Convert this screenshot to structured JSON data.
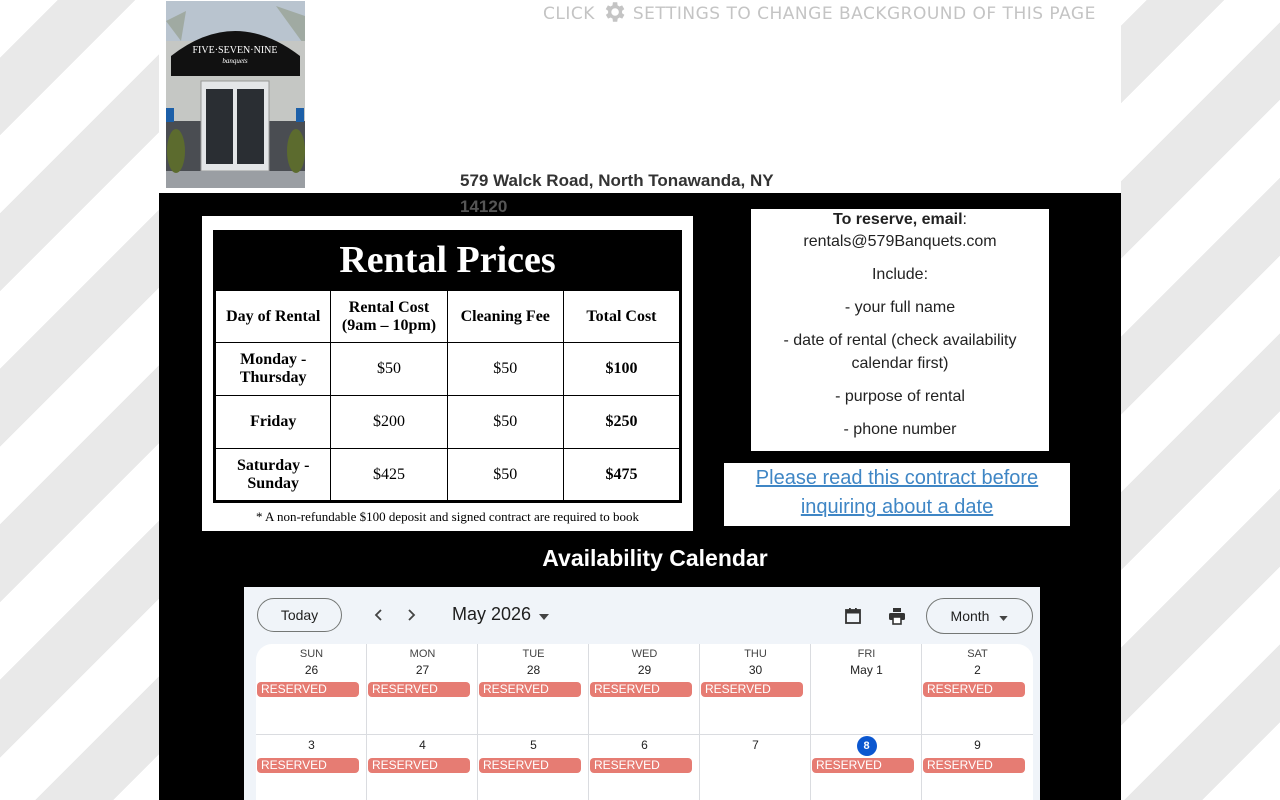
{
  "header": {
    "banner_text": "CLICK",
    "banner_text_2": "SETTINGS TO CHANGE BACKGROUND OF THIS PAGE",
    "logo_text": "FIVE·SEVEN·NINE",
    "logo_subtext": "banquets",
    "address": "579 Walck Road, North Tonawanda, NY",
    "zip": "14120"
  },
  "prices": {
    "title": "Rental Prices",
    "headers": [
      "Day of Rental",
      "Rental Cost (9am – 10pm)",
      "Cleaning Fee",
      "Total Cost"
    ],
    "rows": [
      {
        "day": "Monday - Thursday",
        "rental": "$50",
        "cleaning": "$50",
        "total": "$100"
      },
      {
        "day": "Friday",
        "rental": "$200",
        "cleaning": "$50",
        "total": "$250"
      },
      {
        "day": "Saturday - Sunday",
        "rental": "$425",
        "cleaning": "$50",
        "total": "$475"
      }
    ],
    "note": "* A non-refundable $100 deposit and signed contract are required to book"
  },
  "reserve": {
    "heading": "To reserve, email",
    "colon": ":",
    "email": "rentals@579Banquets.com",
    "include": "Include:",
    "item1": "- your full name",
    "item2": "- date of rental (check availability calendar first)",
    "item3": "- purpose of rental",
    "item4": "- phone number"
  },
  "contract_link": "Please read this contract before inquiring about a date",
  "availability_title": "Availability Calendar",
  "calendar": {
    "today_label": "Today",
    "month_label": "May 2026",
    "view_label": "Month",
    "event_label": "RESERVED",
    "event_color": "#e67c73",
    "today_color": "#0b57d0",
    "week1": [
      {
        "dow": "SUN",
        "num": "26",
        "reserved": true
      },
      {
        "dow": "MON",
        "num": "27",
        "reserved": true
      },
      {
        "dow": "TUE",
        "num": "28",
        "reserved": true
      },
      {
        "dow": "WED",
        "num": "29",
        "reserved": true
      },
      {
        "dow": "THU",
        "num": "30",
        "reserved": true
      },
      {
        "dow": "FRI",
        "num": "May 1",
        "reserved": false
      },
      {
        "dow": "SAT",
        "num": "2",
        "reserved": true
      }
    ],
    "week2": [
      {
        "num": "3",
        "reserved": true
      },
      {
        "num": "4",
        "reserved": true
      },
      {
        "num": "5",
        "reserved": true
      },
      {
        "num": "6",
        "reserved": true
      },
      {
        "num": "7",
        "reserved": false
      },
      {
        "num": "8",
        "reserved": true,
        "today": true
      },
      {
        "num": "9",
        "reserved": true
      }
    ]
  }
}
